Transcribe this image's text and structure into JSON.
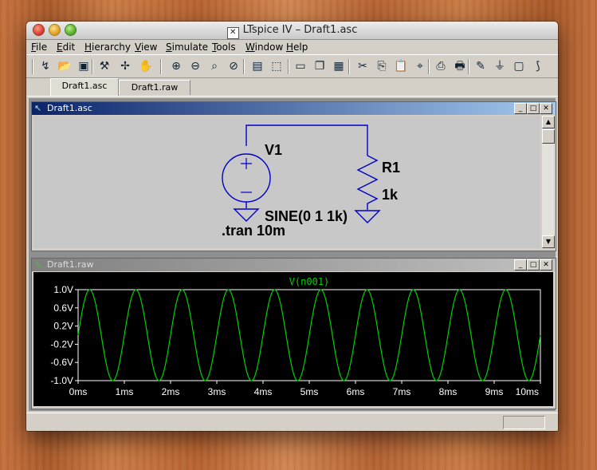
{
  "window": {
    "title": "LTspice IV – Draft1.asc"
  },
  "menu": [
    {
      "key": "F",
      "rest": "ile"
    },
    {
      "key": "E",
      "rest": "dit"
    },
    {
      "key": "H",
      "rest": "ierarchy"
    },
    {
      "key": "V",
      "rest": "iew"
    },
    {
      "key": "S",
      "rest": "imulate"
    },
    {
      "key": "T",
      "rest": "ools"
    },
    {
      "key": "W",
      "rest": "indow"
    },
    {
      "key": "H",
      "rest": "elp"
    }
  ],
  "toolbar_icons": [
    "run-icon",
    "open-icon",
    "save-icon",
    "control-panel-icon",
    "pick-visible-traces-icon",
    "pan-hand-icon",
    "zoom-in-icon",
    "zoom-out-icon",
    "zoom-fit-icon",
    "zoom-cancel-icon",
    "plot-settings-icon",
    "autorange-icon",
    "tile-horizontal-icon",
    "cascade-icon",
    "close-all-icon",
    "cut-icon",
    "copy-icon",
    "paste-icon",
    "find-icon",
    "print-setup-icon",
    "print-icon",
    "draw-wire-icon",
    "ground-icon",
    "label-icon",
    "resistor-icon"
  ],
  "tabs": [
    {
      "label": "Draft1.asc",
      "active": true
    },
    {
      "label": "Draft1.raw",
      "active": false
    }
  ],
  "schematic_window": {
    "title": "Draft1.asc",
    "labels": {
      "v1": "V1",
      "r1": "R1",
      "r1_value": "1k",
      "source_value": "SINE(0 1 1k)",
      "directive": ".tran 10m"
    }
  },
  "waveform_window": {
    "title": "Draft1.raw"
  },
  "chart_data": {
    "type": "line",
    "title": "V(n001)",
    "x_ticks": [
      "0ms",
      "1ms",
      "2ms",
      "3ms",
      "4ms",
      "5ms",
      "6ms",
      "7ms",
      "8ms",
      "9ms",
      "10ms"
    ],
    "y_ticks": [
      "1.0V",
      "0.6V",
      "0.2V",
      "-0.2V",
      "-0.6V",
      "-1.0V"
    ],
    "xlim": [
      0,
      10
    ],
    "ylim": [
      -1.0,
      1.0
    ],
    "series": [
      {
        "name": "V(n001)",
        "function": "sine",
        "amplitude": 1,
        "frequency_khz": 1,
        "offset": 0
      }
    ],
    "grid": false,
    "colors": {
      "background": "#000000",
      "trace": "#00d000",
      "axis_text": "#ffffff"
    }
  },
  "colors": {
    "wire": "#0000c8",
    "title_active": "#0a246a",
    "trace": "#00d000"
  }
}
